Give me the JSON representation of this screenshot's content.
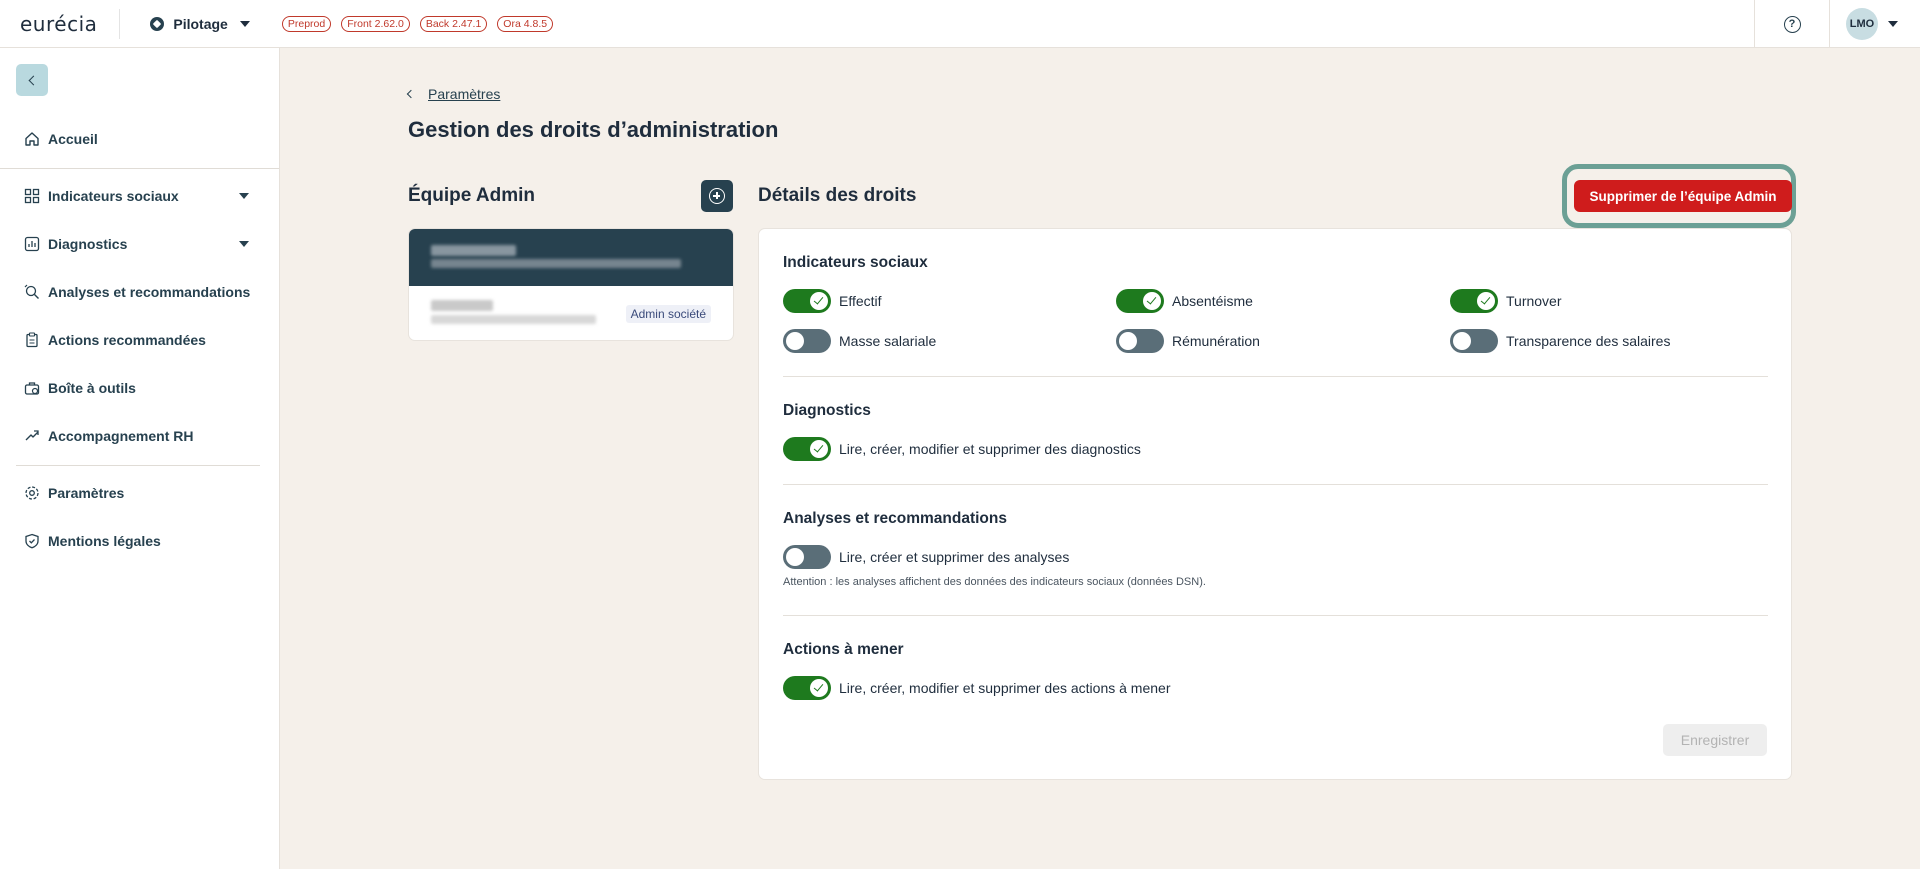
{
  "topbar": {
    "logo": "eurécia",
    "app_name": "Pilotage",
    "badges": [
      "Preprod",
      "Front 2.62.0",
      "Back 2.47.1",
      "Ora 4.8.5"
    ],
    "help": "?",
    "user_initials": "LMO"
  },
  "sidebar": {
    "items": [
      {
        "label": "Accueil",
        "icon": "home-icon"
      },
      {
        "label": "Indicateurs sociaux",
        "icon": "grid-icon"
      },
      {
        "label": "Diagnostics",
        "icon": "chart-icon"
      },
      {
        "label": "Analyses et recommandations",
        "icon": "analysis-icon"
      },
      {
        "label": "Actions recommandées",
        "icon": "clipboard-icon"
      },
      {
        "label": "Boîte à outils",
        "icon": "toolbox-icon"
      },
      {
        "label": "Accompagnement RH",
        "icon": "handshake-icon"
      },
      {
        "label": "Paramètres",
        "icon": "gear-icon"
      },
      {
        "label": "Mentions légales",
        "icon": "shield-icon"
      }
    ]
  },
  "main": {
    "breadcrumb": "Paramètres",
    "title": "Gestion des droits d’administration",
    "team_section_title": "Équipe Admin",
    "member_tag": "Admin société",
    "details_title": "Détails des droits",
    "delete_button": "Supprimer de l’équipe Admin",
    "save_button": "Enregistrer"
  },
  "rights": {
    "indicateurs": {
      "title": "Indicateurs sociaux",
      "items": [
        {
          "label": "Effectif",
          "on": true
        },
        {
          "label": "Absentéisme",
          "on": true
        },
        {
          "label": "Turnover",
          "on": true
        },
        {
          "label": "Masse salariale",
          "on": false
        },
        {
          "label": "Rémunération",
          "on": false
        },
        {
          "label": "Transparence des salaires",
          "on": false
        }
      ]
    },
    "diagnostics": {
      "title": "Diagnostics",
      "label": "Lire, créer, modifier et supprimer des diagnostics",
      "on": true
    },
    "analyses": {
      "title": "Analyses et recommandations",
      "label": "Lire, créer et supprimer des analyses",
      "on": false,
      "warning": "Attention : les analyses affichent des données des indicateurs sociaux (données DSN)."
    },
    "actions": {
      "title": "Actions à mener",
      "label": "Lire, créer, modifier et supprimer des actions à mener",
      "on": true
    }
  },
  "colors": {
    "primary": "#27414f",
    "danger": "#cf1c1c",
    "toggle_on": "#1e7a1e",
    "toggle_off": "#5a6e78",
    "background": "#f5f0ea",
    "highlight_ring": "#6ca095"
  }
}
